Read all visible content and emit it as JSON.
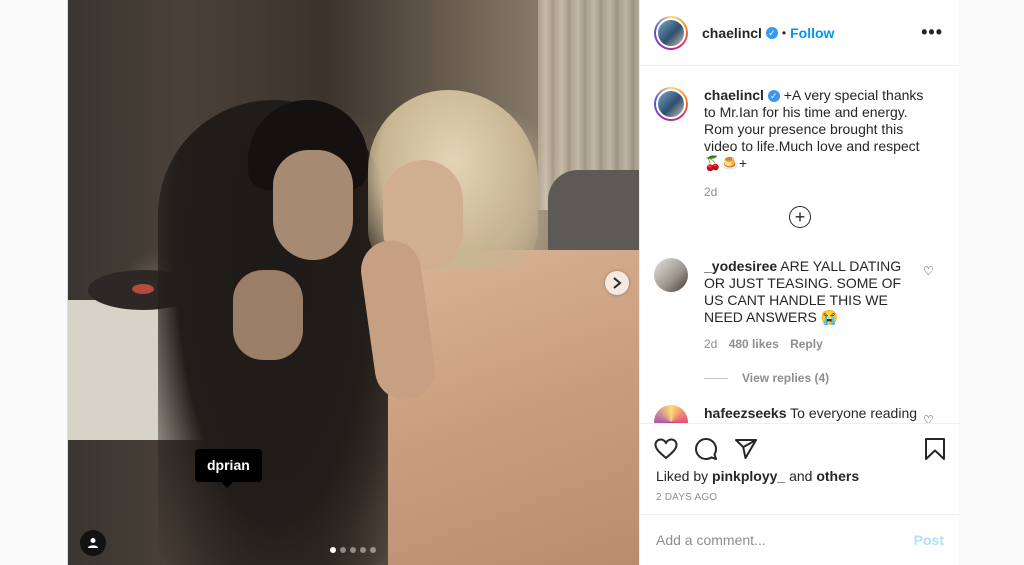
{
  "header": {
    "username": "chaelincl",
    "separator": "•",
    "follow_label": "Follow",
    "more_label": "•••"
  },
  "media": {
    "tag_label": "dprian",
    "carousel_count": 5,
    "carousel_active": 1
  },
  "caption": {
    "username": "chaelincl",
    "text": "+A very special thanks to Mr.Ian for his time and energy. Rom your presence brought this video to life.Much love and respect🍒🍮+",
    "time": "2d"
  },
  "comments": [
    {
      "username": "_yodesiree",
      "text": "ARE YALL DATING OR JUST TEASING. SOME OF US CANT HANDLE THIS WE NEED ANSWERS 😭",
      "time": "2d",
      "likes": "480 likes",
      "reply_label": "Reply",
      "view_replies": "View replies (4)"
    },
    {
      "username": "hafeezseeks",
      "text": "To everyone reading"
    }
  ],
  "actions": {
    "liked_prefix": "Liked by",
    "liked_user": "pinkployy_",
    "liked_and": "and",
    "liked_others": "others",
    "timestamp": "2 DAYS AGO"
  },
  "comment_box": {
    "placeholder": "Add a comment...",
    "post_label": "Post"
  },
  "icons": {
    "like": "heart-icon",
    "comment": "comment-icon",
    "share": "share-icon",
    "save": "bookmark-icon",
    "add": "plus-circle-icon",
    "next": "chevron-right-icon",
    "user_tags": "user-icon"
  }
}
